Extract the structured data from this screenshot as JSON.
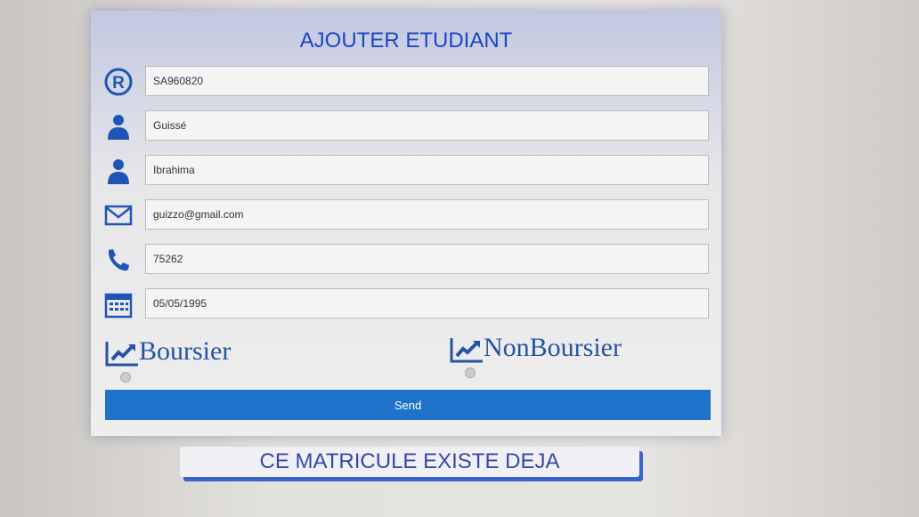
{
  "form": {
    "title": "AJOUTER ETUDIANT",
    "fields": [
      {
        "icon": "registered-icon",
        "value": "SA960820"
      },
      {
        "icon": "user-icon",
        "value": "Guissé"
      },
      {
        "icon": "user-icon",
        "value": "Ibrahima"
      },
      {
        "icon": "envelope-icon",
        "value": "guizzo@gmail.com"
      },
      {
        "icon": "phone-icon",
        "value": "75262"
      },
      {
        "icon": "calendar-icon",
        "value": "05/05/1995"
      }
    ],
    "options": [
      "Boursier",
      "NonBoursier"
    ],
    "send_label": "Send"
  },
  "message": "CE MATRICULE EXISTE DEJA"
}
